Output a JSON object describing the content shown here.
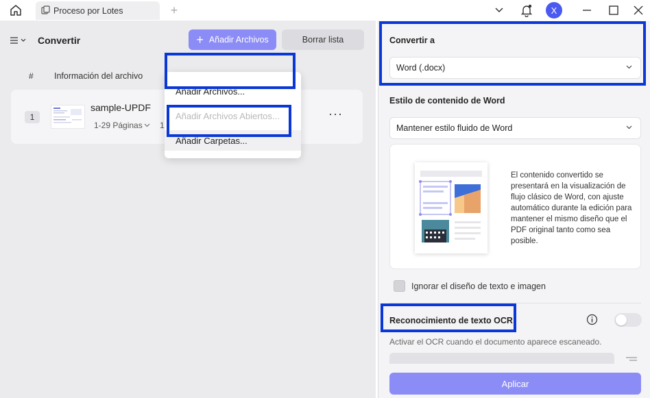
{
  "titlebar": {
    "tab_title": "Proceso por Lotes",
    "avatar_initial": "X"
  },
  "left": {
    "title": "Convertir",
    "add_button": "Añadir Archivos",
    "clear_button": "Borrar lista",
    "columns": {
      "number": "#",
      "info": "Información del archivo"
    },
    "file": {
      "index": "1",
      "name": "sample-UPDF",
      "pages": "1-29 Páginas",
      "extra": "1"
    },
    "dropdown": {
      "items": [
        {
          "label": "Añadir Archivos...",
          "enabled": true
        },
        {
          "label": "Añadir Archivos Abiertos...",
          "enabled": false
        },
        {
          "label": "Añadir Carpetas...",
          "enabled": true
        }
      ]
    }
  },
  "right": {
    "convert_to_label": "Convertir a",
    "convert_to_value": "Word (.docx)",
    "style_label": "Estilo de contenido de Word",
    "style_value": "Mantener estilo fluido de Word",
    "preview_description": "El contenido convertido se presentará en la visualización de flujo clásico de Word, con ajuste automático durante la edición para mantener el mismo diseño que el PDF original tanto como sea posible.",
    "ignore_layout_label": "Ignorar el diseño de texto e imagen",
    "ignore_layout_checked": false,
    "ocr_label": "Reconocimiento de texto OCR",
    "ocr_enabled": false,
    "ocr_description": "Activar el OCR cuando el documento aparece escaneado.",
    "apply_button": "Aplicar"
  },
  "colors": {
    "accent": "#8c8cf6",
    "avatar": "#4a5af0",
    "highlight_box": "#0b37d6"
  }
}
